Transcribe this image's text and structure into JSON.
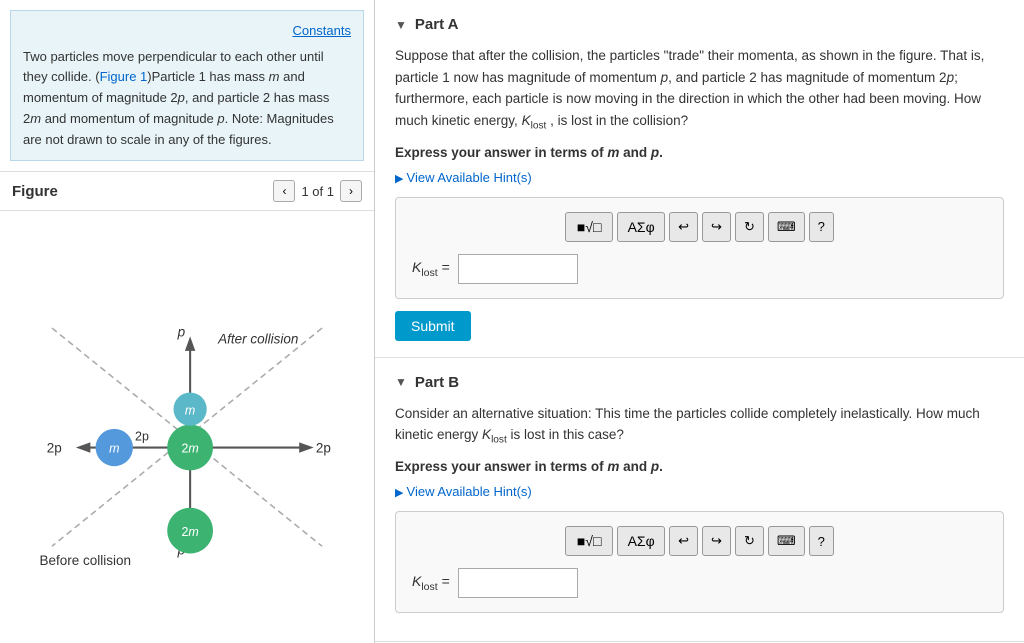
{
  "left": {
    "constants_label": "Constants",
    "problem_text_line1": "Two particles move perpendicular to each other until they",
    "problem_text_line2": "collide. (Figure 1)Particle 1 has mass ",
    "problem_text_m": "m",
    "problem_text_line3": " and momentum",
    "problem_text_line4": "of magnitude 2",
    "problem_text_2p": "p",
    "problem_text_line5": ", and particle 2 has mass 2",
    "problem_text_2m": "m",
    "problem_text_line6": " and",
    "problem_text_line7": "momentum of magnitude ",
    "problem_text_p": "p",
    "problem_text_line8": ". Note: Magnitudes are not",
    "problem_text_line9": "drawn to scale in any of the figures.",
    "figure_title": "Figure",
    "page_indicator": "1 of 1"
  },
  "right": {
    "partA": {
      "title": "Part A",
      "collapse_symbol": "▼",
      "description": "Suppose that after the collision, the particles \"trade\" their momenta, as shown in the figure. That is, particle 1 now has magnitude of momentum p, and particle 2 has magnitude of momentum 2p; furthermore, each particle is now moving in the direction in which the other had been moving. How much kinetic energy, K",
      "desc_subscript": "lost",
      "desc_end": ", is lost in the collision?",
      "express_answer": "Express your answer in terms of",
      "express_m": "m",
      "express_and": "and",
      "express_p": "p",
      "hint_label": "View Available Hint(s)",
      "toolbar_buttons": [
        "■√□",
        "ΑΣφ",
        "↩",
        "↪",
        "↻",
        "⌨",
        "?"
      ],
      "input_label_K": "K",
      "input_label_sub": "lost",
      "input_label_eq": "=",
      "input_placeholder": "",
      "submit_label": "Submit"
    },
    "partB": {
      "title": "Part B",
      "collapse_symbol": "▼",
      "description": "Consider an alternative situation: This time the particles collide completely inelastically. How much kinetic energy K",
      "desc_subscript": "lost",
      "desc_end": " is lost in this case?",
      "express_answer": "Express your answer in terms of",
      "express_m": "m",
      "express_and": "and",
      "express_p": "p",
      "hint_label": "View Available Hint(s)",
      "toolbar_buttons": [
        "■√□",
        "ΑΣφ",
        "↩",
        "↪",
        "↻",
        "⌨",
        "?"
      ],
      "input_label_K": "K",
      "input_label_sub": "lost",
      "input_label_eq": "=",
      "input_placeholder": ""
    }
  }
}
